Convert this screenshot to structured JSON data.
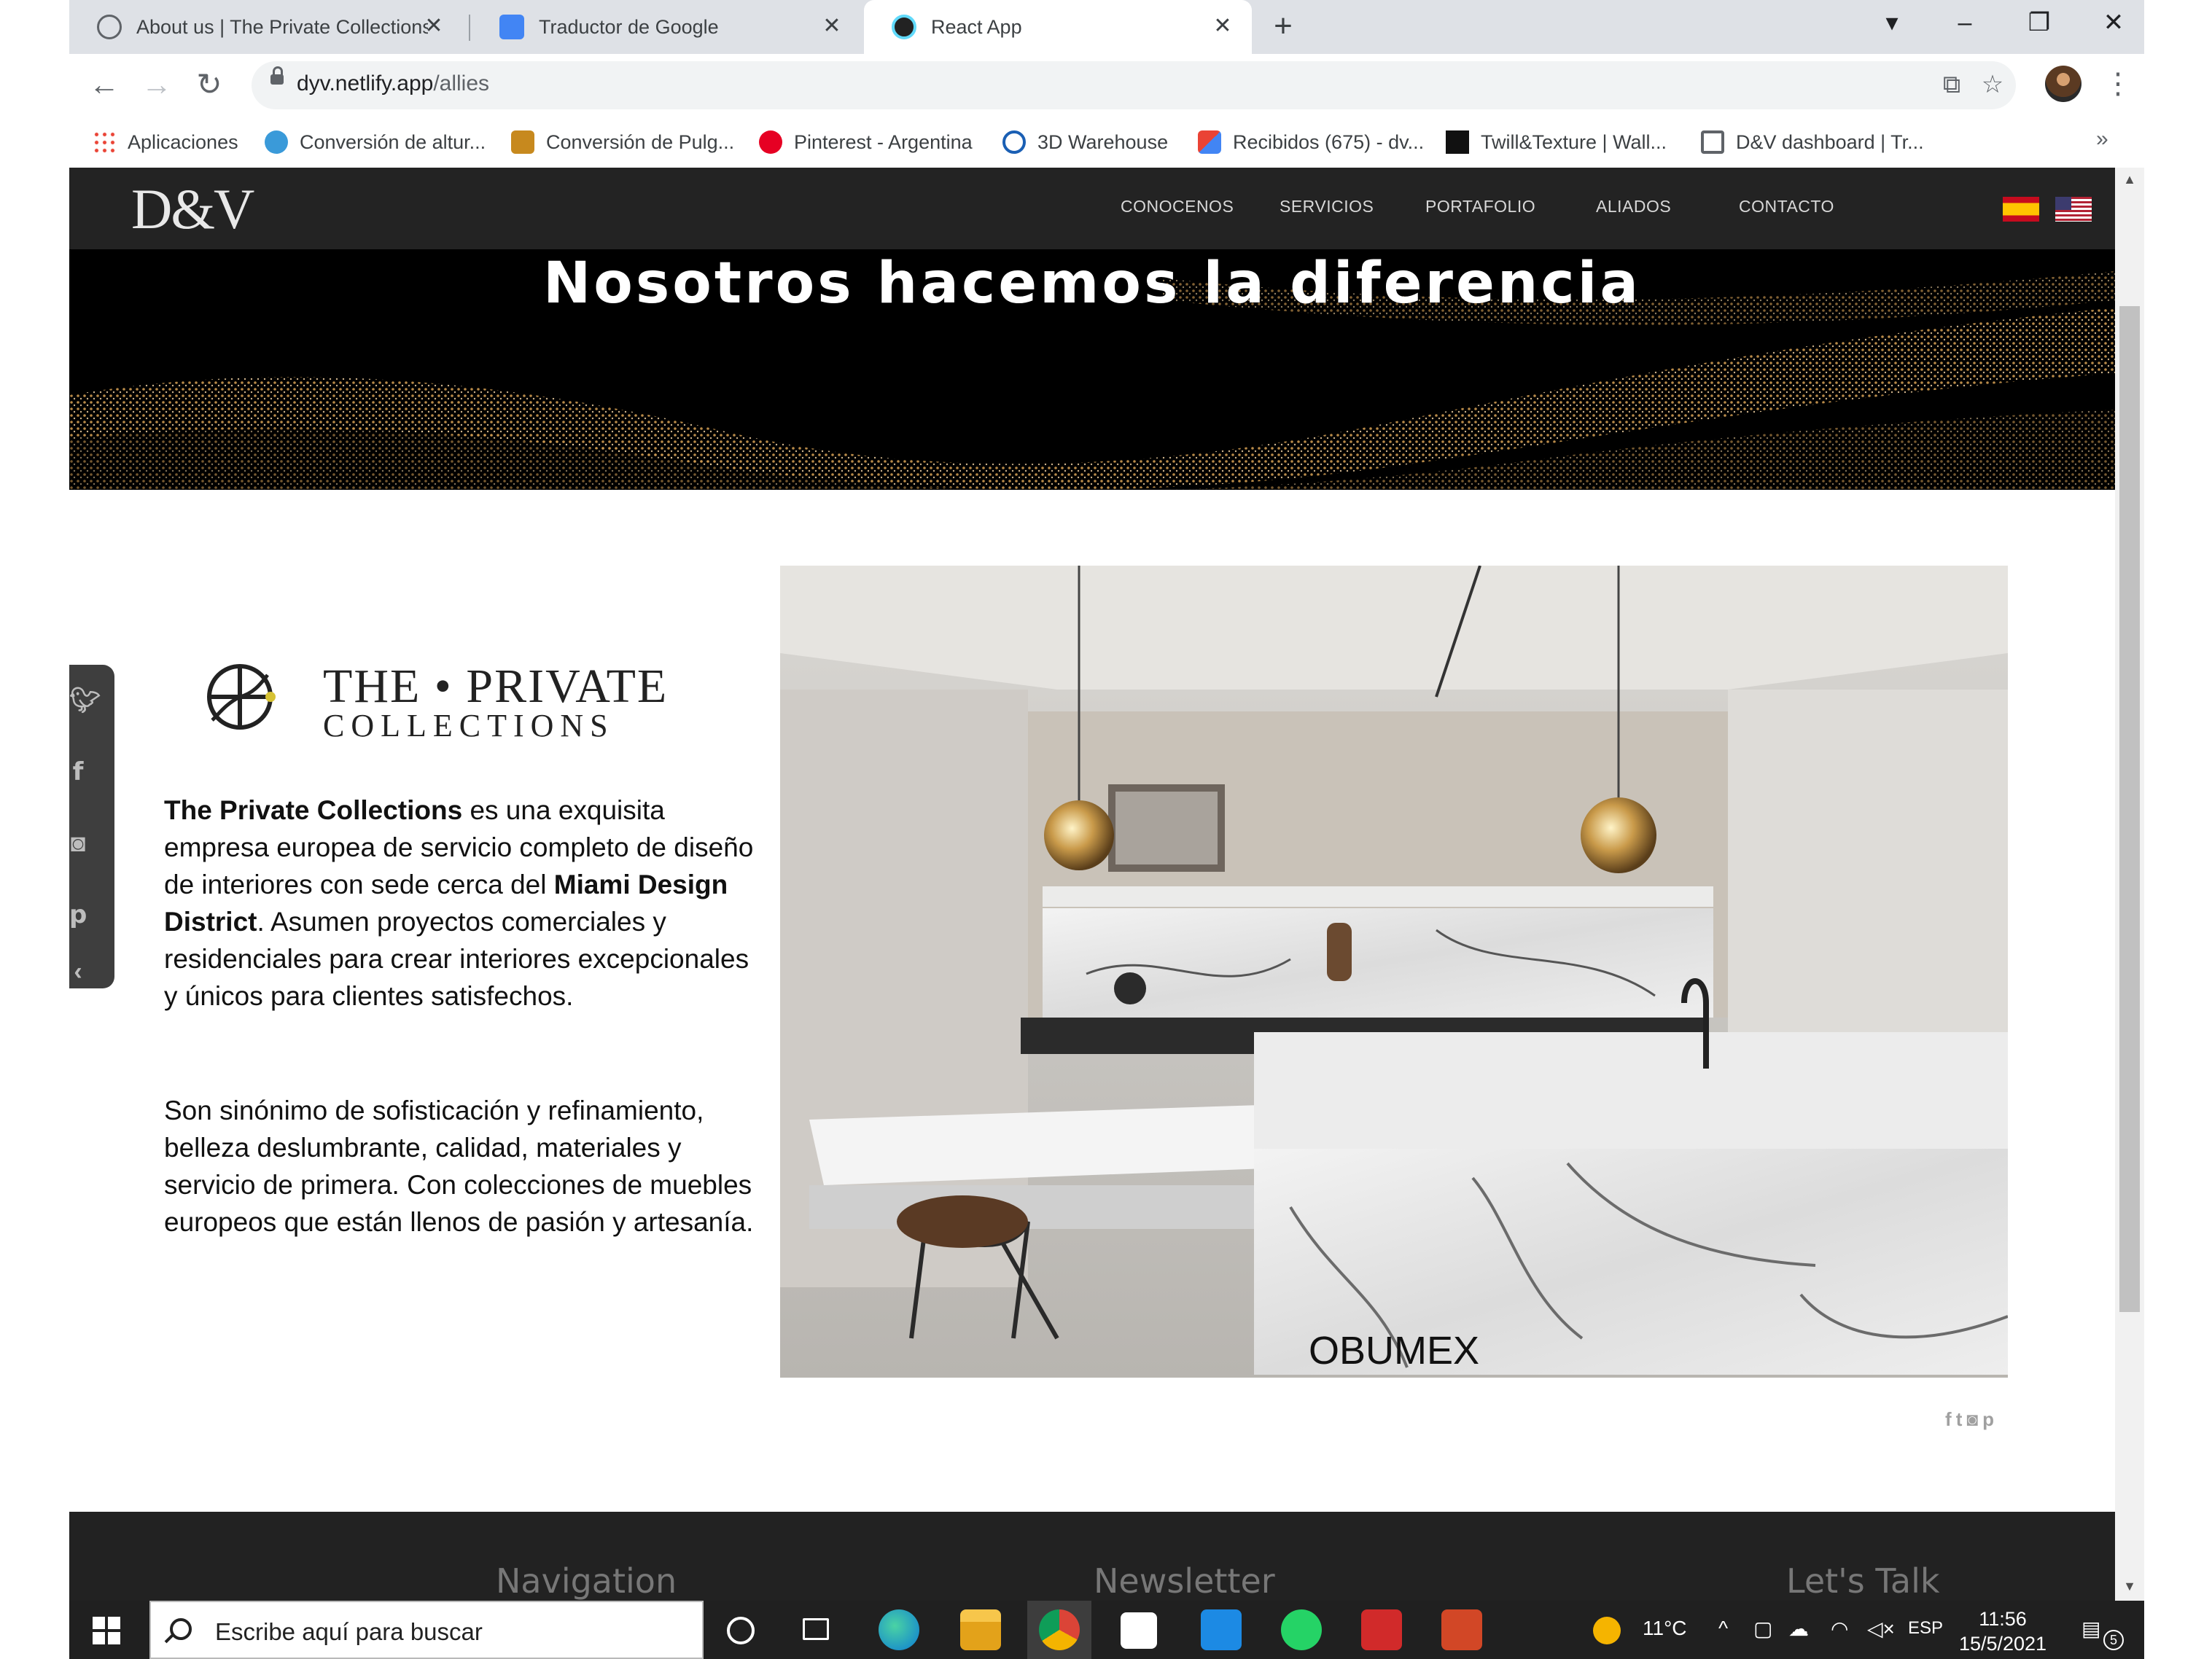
{
  "browser": {
    "tabs": [
      {
        "title": "About us | The Private Collections",
        "active": false
      },
      {
        "title": "Traductor de Google",
        "active": false
      },
      {
        "title": "React App",
        "active": true
      }
    ],
    "new_tab_label": "+",
    "address": {
      "host": "dyv.netlify.app",
      "path": "/allies"
    },
    "bookmarks": [
      {
        "label": "Aplicaciones",
        "icon": "apps-grid-icon"
      },
      {
        "label": "Conversión de altur...",
        "icon": "globe-icon"
      },
      {
        "label": "Conversión de Pulg...",
        "icon": "ruler-icon"
      },
      {
        "label": "Pinterest - Argentina",
        "icon": "pinterest-icon"
      },
      {
        "label": "3D Warehouse",
        "icon": "warehouse-icon"
      },
      {
        "label": "Recibidos (675) - dv...",
        "icon": "gmail-icon"
      },
      {
        "label": "Twill&Texture | Wall...",
        "icon": "twill-icon"
      },
      {
        "label": "D&V dashboard | Tr...",
        "icon": "trello-icon"
      }
    ],
    "bookmarks_overflow": "»"
  },
  "site": {
    "logo": "D&V",
    "nav": [
      "CONOCENOS",
      "SERVICIOS",
      "PORTAFOLIO",
      "ALIADOS",
      "CONTACTO"
    ],
    "hero_title": "Nosotros hacemos la diferencia",
    "partner": {
      "logo_line1": "THE • PRIVATE",
      "logo_line2": "COLLECTIONS",
      "para1": [
        {
          "text": "The Private Collections",
          "bold": true
        },
        {
          "text": " es una exquisita empresa europea de servicio completo de diseño de interiores con sede cerca del ",
          "bold": false
        },
        {
          "text": "Miami Design District",
          "bold": true
        },
        {
          "text": ". Asumen proyectos comerciales y residenciales para crear interiores excepcionales y únicos para clientes satisfechos.",
          "bold": false
        }
      ],
      "para2": "Son sinónimo de sofisticación y refinamiento, belleza deslumbrante, calidad, materiales y servicio de primera. Con colecciones de muebles europeos que están llenos de pasión y artesanía."
    },
    "photo_caption": "OBUMEX",
    "footer": {
      "col1": "Navigation",
      "col2": "Newsletter",
      "col3": "Let's Talk"
    }
  },
  "taskbar": {
    "search_placeholder": "Escribe aquí para buscar",
    "weather": "11°C",
    "language": "ESP",
    "time": "11:56",
    "date": "15/5/2021",
    "notifications": "5"
  },
  "colors": {
    "site_nav_bg": "#232323",
    "footer_bg": "#222222",
    "hero_bg": "#000000",
    "hero_sparkle": "#d8a255"
  }
}
